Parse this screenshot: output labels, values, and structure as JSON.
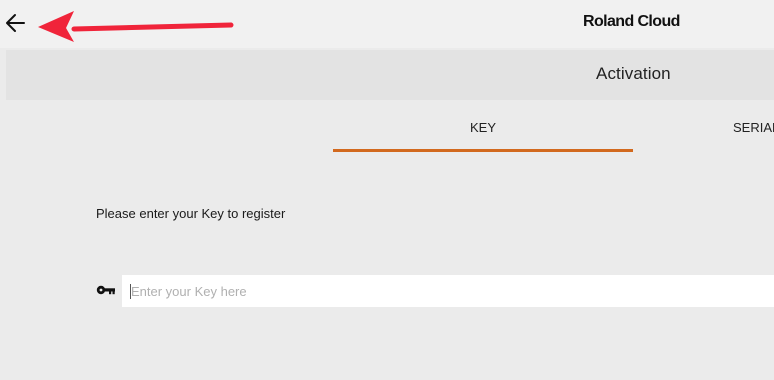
{
  "header": {
    "back_icon": "arrow-left-icon",
    "brand": "Roland Cloud"
  },
  "page": {
    "title": "Activation"
  },
  "tabs": [
    {
      "label": "KEY",
      "active": true
    },
    {
      "label": "SERIAL",
      "active": false
    }
  ],
  "form": {
    "instruction": "Please enter your Key to register",
    "key_icon": "key-icon",
    "key_value": "",
    "key_placeholder": "Enter your Key here"
  },
  "colors": {
    "active_tab_underline": "#d2691e",
    "annotation_arrow": "#f0243a",
    "background": "#ebebeb",
    "topbar": "#f1f1f1",
    "title_bar": "#e3e3e3"
  }
}
